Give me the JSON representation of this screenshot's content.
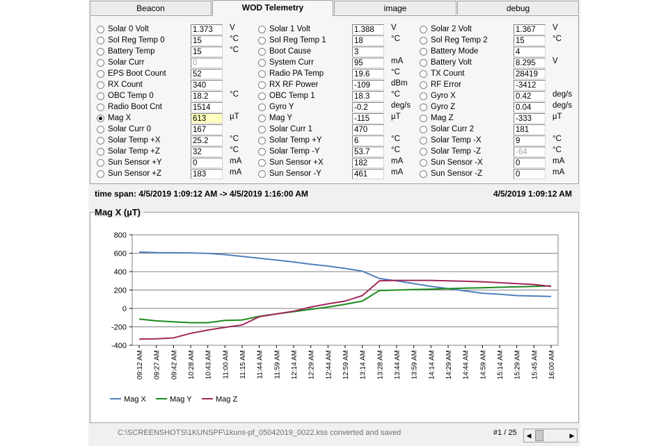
{
  "tabs": [
    {
      "label": "Beacon",
      "active": false
    },
    {
      "label": "WOD Telemetry",
      "active": true
    },
    {
      "label": "image",
      "active": false
    },
    {
      "label": "debug",
      "active": false
    }
  ],
  "columns": [
    [
      {
        "label": "Solar 0 Volt",
        "value": "1.373",
        "unit": "V"
      },
      {
        "label": "Sol Reg Temp 0",
        "value": "15",
        "unit": "°C"
      },
      {
        "label": "Battery Temp",
        "value": "15",
        "unit": "°C"
      },
      {
        "label": "Solar Curr",
        "value": "0",
        "unit": "",
        "dim": true
      },
      {
        "label": "EPS Boot Count",
        "value": "52",
        "unit": ""
      },
      {
        "label": "RX Count",
        "value": "340",
        "unit": ""
      },
      {
        "label": "OBC Temp 0",
        "value": "18.2",
        "unit": "°C"
      },
      {
        "label": "Radio Boot Cnt",
        "value": "1514",
        "unit": ""
      },
      {
        "label": "Mag X",
        "value": "613",
        "unit": "µT",
        "selected": true,
        "highlight": true
      },
      {
        "label": "Solar Curr 0",
        "value": "167",
        "unit": ""
      },
      {
        "label": "Solar Temp +X",
        "value": "25.2",
        "unit": "°C"
      },
      {
        "label": "Solar Temp +Z",
        "value": "32",
        "unit": "°C"
      },
      {
        "label": "Sun Sensor +Y",
        "value": "0",
        "unit": "mA"
      },
      {
        "label": "Sun Sensor +Z",
        "value": "183",
        "unit": "mA"
      }
    ],
    [
      {
        "label": "Solar 1 Volt",
        "value": "1.388",
        "unit": "V"
      },
      {
        "label": "Sol Reg Temp 1",
        "value": "18",
        "unit": "°C"
      },
      {
        "label": "Boot Cause",
        "value": "3",
        "unit": ""
      },
      {
        "label": "System Curr",
        "value": "95",
        "unit": "mA"
      },
      {
        "label": "Radio PA Temp",
        "value": "19.6",
        "unit": "°C"
      },
      {
        "label": "RX RF Power",
        "value": "-109",
        "unit": "dBm"
      },
      {
        "label": "OBC Temp 1",
        "value": "18.3",
        "unit": "°C"
      },
      {
        "label": "Gyro Y",
        "value": "-0.2",
        "unit": "deg/s"
      },
      {
        "label": "Mag Y",
        "value": "-115",
        "unit": "µT"
      },
      {
        "label": "Solar Curr 1",
        "value": "470",
        "unit": ""
      },
      {
        "label": "Solar Temp +Y",
        "value": "6",
        "unit": "°C"
      },
      {
        "label": "Solar Temp -Y",
        "value": "53.7",
        "unit": "°C"
      },
      {
        "label": "Sun Sensor +X",
        "value": "182",
        "unit": "mA"
      },
      {
        "label": "Sun Sensor -Y",
        "value": "461",
        "unit": "mA"
      }
    ],
    [
      {
        "label": "Solar 2 Volt",
        "value": "1.367",
        "unit": "V"
      },
      {
        "label": "Sol Reg Temp 2",
        "value": "15",
        "unit": "°C"
      },
      {
        "label": "Battery Mode",
        "value": "4",
        "unit": ""
      },
      {
        "label": "Battery Volt",
        "value": "8.295",
        "unit": "V"
      },
      {
        "label": "TX Count",
        "value": "28419",
        "unit": ""
      },
      {
        "label": "RF Error",
        "value": "-3412",
        "unit": ""
      },
      {
        "label": "Gyro X",
        "value": "0.42",
        "unit": "deg/s"
      },
      {
        "label": "Gyro Z",
        "value": "0.04",
        "unit": "deg/s"
      },
      {
        "label": "Mag Z",
        "value": "-333",
        "unit": "µT"
      },
      {
        "label": "Solar Curr 2",
        "value": "181",
        "unit": ""
      },
      {
        "label": "Solar Temp -X",
        "value": "9",
        "unit": "°C"
      },
      {
        "label": "Solar Temp -Z",
        "value": "-64",
        "unit": "°C",
        "dim": true
      },
      {
        "label": "Sun Sensor -X",
        "value": "0",
        "unit": "mA"
      },
      {
        "label": "Sun Sensor -Z",
        "value": "0",
        "unit": "mA"
      }
    ]
  ],
  "timespan": {
    "label": "time span:  4/5/2019 1:09:12 AM  ->  4/5/2019 1:16:00 AM",
    "current": "4/5/2019 1:09:12 AM"
  },
  "chart_title": "Mag X (µT)",
  "chart_data": {
    "type": "line",
    "title": "Mag X (µT)",
    "categories": [
      "09:12 AM",
      "09:27 AM",
      "09:42 AM",
      "10:28 AM",
      "10:43 AM",
      "11:00 AM",
      "11:15 AM",
      "11:44 AM",
      "11:59 AM",
      "12:14 AM",
      "12:29 AM",
      "12:44 AM",
      "12:59 AM",
      "13:14 AM",
      "13:28 AM",
      "13:44 AM",
      "13:59 AM",
      "14:14 AM",
      "14:29 AM",
      "14:44 AM",
      "14:59 AM",
      "15:14 AM",
      "15:29 AM",
      "15:45 AM",
      "16:00 AM"
    ],
    "ylim": [
      -400,
      800
    ],
    "yticks": [
      -400,
      -200,
      0,
      200,
      400,
      600,
      800
    ],
    "grid": true,
    "legend_position": "bottom-left",
    "series": [
      {
        "name": "Mag X",
        "color": "#4f81bd",
        "values": [
          613,
          607,
          605,
          603,
          598,
          585,
          565,
          545,
          525,
          505,
          480,
          460,
          435,
          405,
          325,
          300,
          270,
          240,
          215,
          190,
          165,
          155,
          140,
          135,
          130
        ]
      },
      {
        "name": "Mag Y",
        "color": "#1a8a1a",
        "values": [
          -115,
          -135,
          -145,
          -155,
          -155,
          -130,
          -125,
          -85,
          -60,
          -35,
          -10,
          15,
          45,
          80,
          195,
          200,
          205,
          210,
          215,
          220,
          225,
          230,
          235,
          240,
          245
        ]
      },
      {
        "name": "Mag Z",
        "color": "#a0285a",
        "values": [
          -333,
          -330,
          -320,
          -270,
          -235,
          -205,
          -180,
          -90,
          -60,
          -30,
          15,
          50,
          80,
          140,
          300,
          305,
          305,
          305,
          300,
          295,
          290,
          280,
          270,
          260,
          240
        ]
      }
    ]
  },
  "status": {
    "path": "C:\\SCREENSHOTS\\1KUNSPF\\1kuns-pf_05042019_0022.kss converted and saved",
    "page": "#1 / 25"
  }
}
